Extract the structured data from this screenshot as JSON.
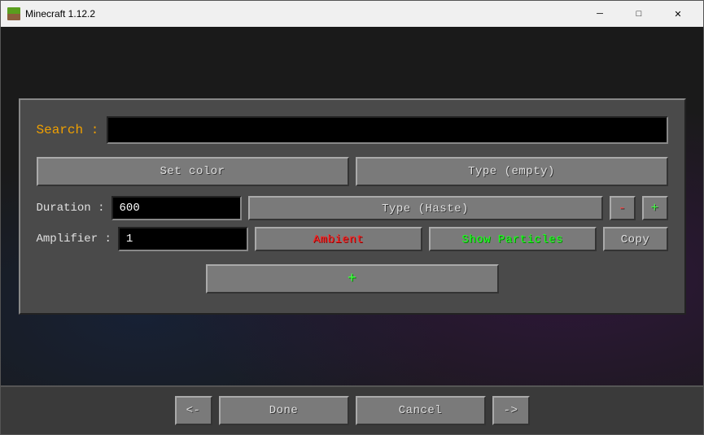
{
  "titleBar": {
    "title": "Minecraft 1.12.2",
    "minimizeLabel": "─",
    "maximizeLabel": "□",
    "closeLabel": "✕"
  },
  "search": {
    "label": "Search :",
    "placeholder": "",
    "value": ""
  },
  "buttons": {
    "setColor": "Set color",
    "typeEmpty": "Type (empty)",
    "typeHaste": "Type (Haste)",
    "minus": "-",
    "plus": "+",
    "ambient": "Ambient",
    "showParticles": "Show Particles",
    "copy": "Copy",
    "addEffect": "+",
    "prev": "<-",
    "done": "Done",
    "cancel": "Cancel",
    "next": "->"
  },
  "fields": {
    "durationLabel": "Duration :",
    "durationValue": "600",
    "amplifierLabel": "Amplifier :",
    "amplifierValue": "1"
  }
}
